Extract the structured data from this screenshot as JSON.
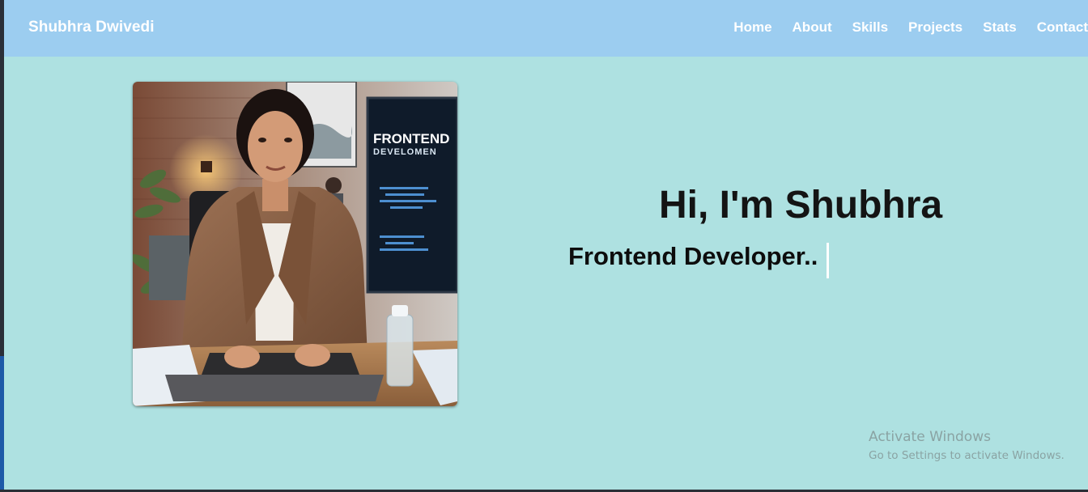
{
  "navbar": {
    "brand": "Shubhra Dwivedi",
    "links": [
      "Home",
      "About",
      "Skills",
      "Projects",
      "Stats",
      "Contact"
    ]
  },
  "hero": {
    "title": "Hi, I'm Shubhra",
    "subtitle": "Frontend Developer..",
    "photo": {
      "screen_text_line1": "FRONTEND",
      "screen_text_line2": "DEVELOMEN"
    }
  },
  "watermark": {
    "title": "Activate Windows",
    "subtitle": "Go to Settings to activate Windows."
  },
  "colors": {
    "navbar_bg": "#9ccdf0",
    "page_bg": "#aee1e1",
    "text_dark": "#141414",
    "nav_text": "#ffffff"
  }
}
